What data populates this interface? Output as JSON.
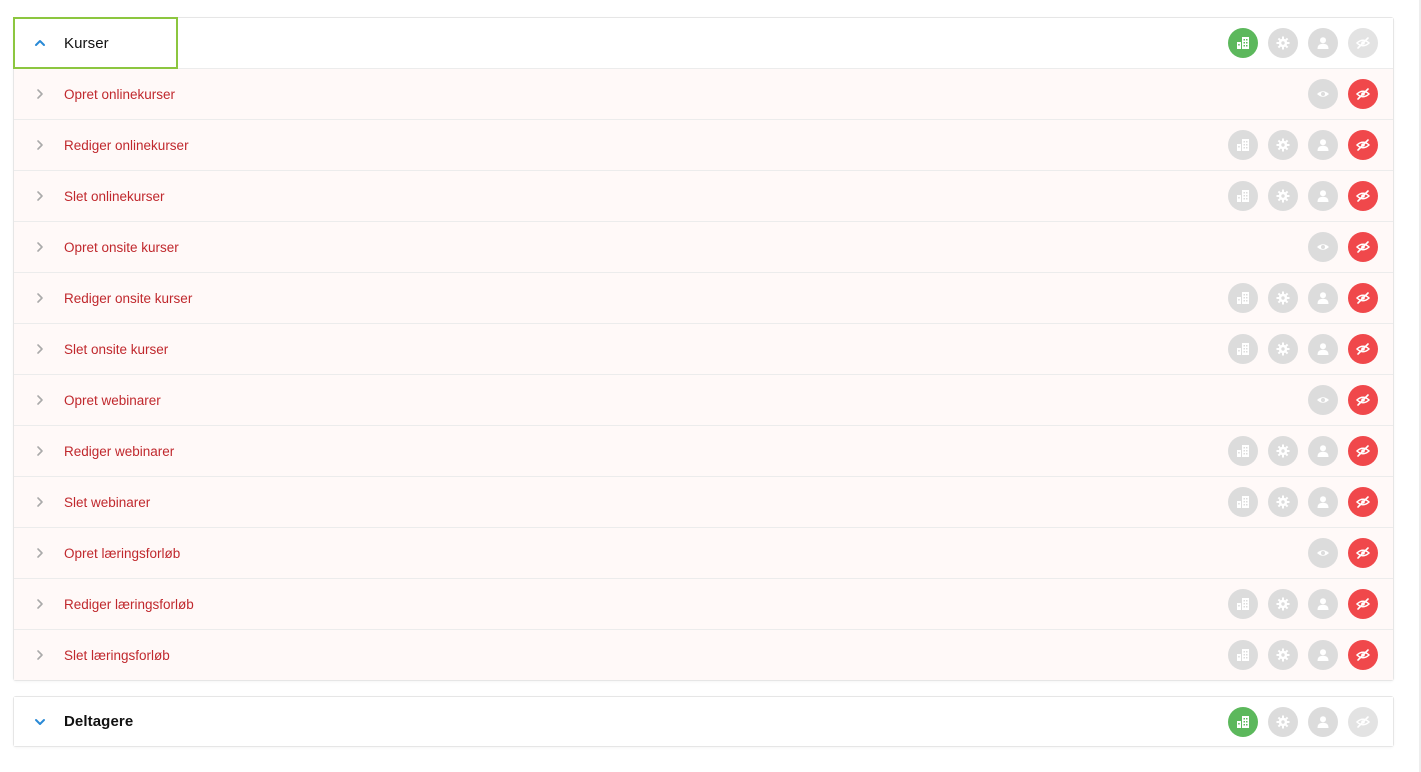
{
  "colors": {
    "accent_green": "#5cb85c",
    "deny_red": "#f0484b",
    "neutral_gray": "#dcdcdc",
    "focus_green": "#8cc63f",
    "label_red": "#c0282d",
    "chevron_blue": "#2a8ad6"
  },
  "groups": [
    {
      "title": "Kurser",
      "expanded": true,
      "icons": [
        "building-icon",
        "gear-icon",
        "user-icon",
        "eye-slash-icon"
      ],
      "active_icon": "building-icon",
      "items": [
        {
          "label": "Opret onlinekurser",
          "icons": [
            "eye-icon",
            "eye-slash-icon"
          ]
        },
        {
          "label": "Rediger onlinekurser",
          "icons": [
            "building-icon",
            "gear-icon",
            "user-icon",
            "eye-slash-icon"
          ]
        },
        {
          "label": "Slet onlinekurser",
          "icons": [
            "building-icon",
            "gear-icon",
            "user-icon",
            "eye-slash-icon"
          ]
        },
        {
          "label": "Opret onsite kurser",
          "icons": [
            "eye-icon",
            "eye-slash-icon"
          ]
        },
        {
          "label": "Rediger onsite kurser",
          "icons": [
            "building-icon",
            "gear-icon",
            "user-icon",
            "eye-slash-icon"
          ]
        },
        {
          "label": "Slet onsite kurser",
          "icons": [
            "building-icon",
            "gear-icon",
            "user-icon",
            "eye-slash-icon"
          ]
        },
        {
          "label": "Opret webinarer",
          "icons": [
            "eye-icon",
            "eye-slash-icon"
          ]
        },
        {
          "label": "Rediger webinarer",
          "icons": [
            "building-icon",
            "gear-icon",
            "user-icon",
            "eye-slash-icon"
          ]
        },
        {
          "label": "Slet webinarer",
          "icons": [
            "building-icon",
            "gear-icon",
            "user-icon",
            "eye-slash-icon"
          ]
        },
        {
          "label": "Opret læringsforløb",
          "icons": [
            "eye-icon",
            "eye-slash-icon"
          ]
        },
        {
          "label": "Rediger læringsforløb",
          "icons": [
            "building-icon",
            "gear-icon",
            "user-icon",
            "eye-slash-icon"
          ]
        },
        {
          "label": "Slet læringsforløb",
          "icons": [
            "building-icon",
            "gear-icon",
            "user-icon",
            "eye-slash-icon"
          ]
        }
      ]
    },
    {
      "title": "Deltagere",
      "expanded": false,
      "icons": [
        "building-icon",
        "gear-icon",
        "user-icon",
        "eye-slash-icon"
      ],
      "active_icon": "building-icon",
      "items": []
    }
  ]
}
